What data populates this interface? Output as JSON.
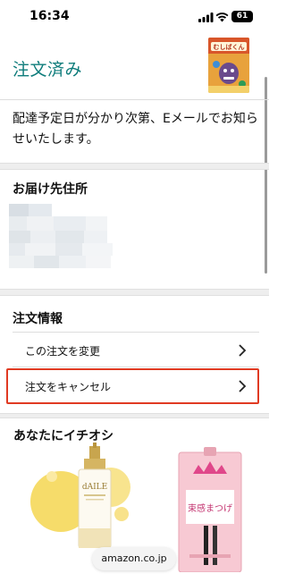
{
  "status_bar": {
    "time": "16:34",
    "battery": "61"
  },
  "order": {
    "title": "注文済み",
    "product_image_icon": "book-cover-mushibakun",
    "product_cover_text": "むしばくん"
  },
  "delivery": {
    "message": "配達予定日が分かり次第、Eメールでお知らせいたします。"
  },
  "shipping": {
    "heading": "お届け先住所"
  },
  "order_info": {
    "heading": "注文情報",
    "items": [
      {
        "label": "この注文を変更",
        "icon": "chevron-right-icon"
      },
      {
        "label": "注文をキャンセル",
        "icon": "chevron-right-icon"
      }
    ]
  },
  "recommendations": {
    "heading": "あなたにイチオシ",
    "products": [
      {
        "brand_text": "dAILE"
      },
      {
        "brand_text": "束感まつげ"
      }
    ]
  },
  "browser": {
    "url": "amazon.co.jp"
  },
  "colors": {
    "title_teal": "#0e7c7b",
    "highlight_red": "#e03a22",
    "separator": "#eeeeee"
  }
}
